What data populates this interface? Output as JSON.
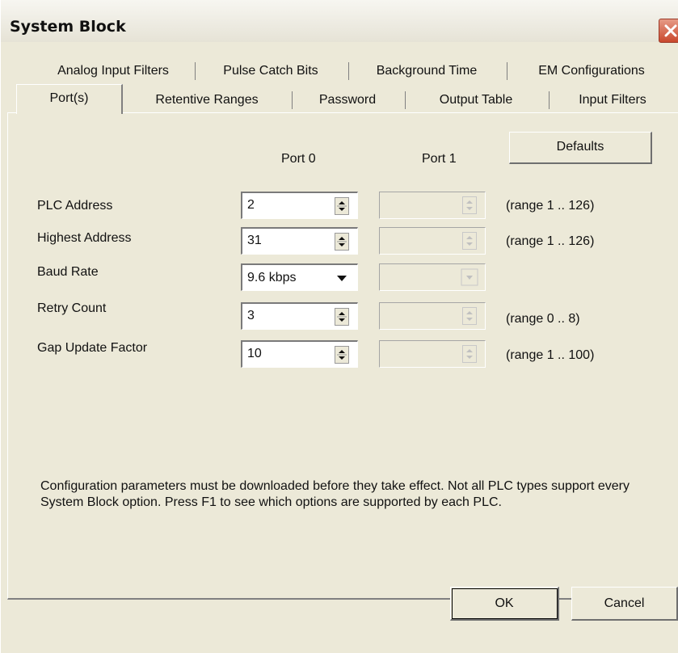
{
  "window": {
    "title": "System Block"
  },
  "tabs_row1": [
    "Analog Input Filters",
    "Pulse Catch Bits",
    "Background Time",
    "EM Configurations"
  ],
  "tabs_row2": [
    "Port(s)",
    "Retentive Ranges",
    "Password",
    "Output Table",
    "Input Filters"
  ],
  "active_tab": "Port(s)",
  "ports": {
    "port0_header": "Port 0",
    "port1_header": "Port 1",
    "defaults_button": "Defaults"
  },
  "fields": [
    {
      "label": "PLC Address",
      "value": "2",
      "range": "(range 1 .. 126)"
    },
    {
      "label": "Highest Address",
      "value": "31",
      "range": "(range 1 .. 126)"
    },
    {
      "label": "Baud Rate",
      "value": "9.6 kbps",
      "range": ""
    },
    {
      "label": "Retry Count",
      "value": "3",
      "range": "(range 0 .. 8)"
    },
    {
      "label": "Gap Update Factor",
      "value": "10",
      "range": "(range 1 .. 100)"
    }
  ],
  "info": "Configuration parameters must be downloaded before they take effect. Not all PLC types support every System Block option. Press F1 to see which options are supported by each PLC.",
  "buttons": {
    "ok": "OK",
    "cancel": "Cancel"
  },
  "icons": {
    "close": "close-icon",
    "spin": "spin-arrows-icon",
    "dropdown": "chevron-down-icon"
  },
  "colors": {
    "dialog_bg": "#ece9d8",
    "close_button": "#c9482d"
  }
}
